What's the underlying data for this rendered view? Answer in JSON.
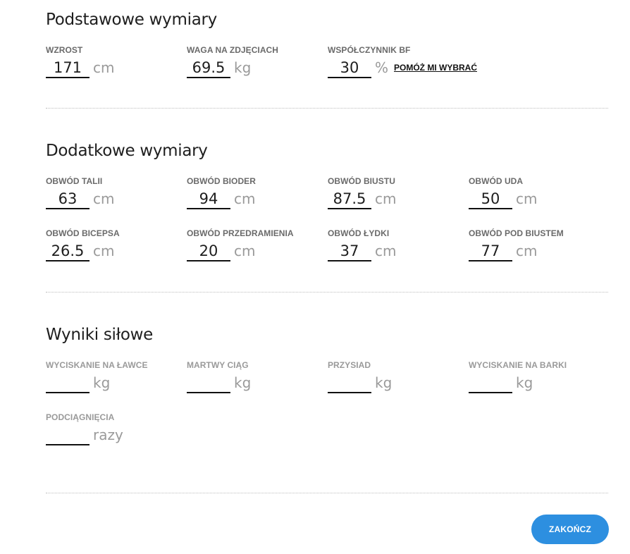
{
  "basic": {
    "title": "Podstawowe wymiary",
    "height": {
      "label": "WZROST",
      "value": "171",
      "unit": "cm"
    },
    "weight": {
      "label": "WAGA NA ZDJĘCIACH",
      "value": "69.5",
      "unit": "kg"
    },
    "body_fat": {
      "label": "WSPÓŁCZYNNIK BF",
      "value": "30",
      "unit": "%",
      "help_label": "POMÓŻ MI WYBRAĆ"
    }
  },
  "additional": {
    "title": "Dodatkowe wymiary",
    "waist": {
      "label": "OBWÓD TALII",
      "value": "63",
      "unit": "cm"
    },
    "hips": {
      "label": "OBWÓD BIODER",
      "value": "94",
      "unit": "cm"
    },
    "bust": {
      "label": "OBWÓD BIUSTU",
      "value": "87.5",
      "unit": "cm"
    },
    "thigh": {
      "label": "OBWÓD UDA",
      "value": "50",
      "unit": "cm"
    },
    "biceps": {
      "label": "OBWÓD BICEPSA",
      "value": "26.5",
      "unit": "cm"
    },
    "forearm": {
      "label": "OBWÓD PRZEDRAMIENIA",
      "value": "20",
      "unit": "cm"
    },
    "calf": {
      "label": "OBWÓD ŁYDKI",
      "value": "37",
      "unit": "cm"
    },
    "underbust": {
      "label": "OBWÓD POD BIUSTEM",
      "value": "77",
      "unit": "cm"
    }
  },
  "strength": {
    "title": "Wyniki siłowe",
    "bench_press": {
      "label": "WYCISKANIE NA ŁAWCE",
      "value": "",
      "unit": "kg"
    },
    "deadlift": {
      "label": "MARTWY CIĄG",
      "value": "",
      "unit": "kg"
    },
    "squat": {
      "label": "PRZYSIAD",
      "value": "",
      "unit": "kg"
    },
    "shoulder_press": {
      "label": "WYCISKANIE NA BARKI",
      "value": "",
      "unit": "kg"
    },
    "pullups": {
      "label": "PODCIĄGNIĘCIA",
      "value": "",
      "unit": "razy"
    }
  },
  "actions": {
    "finish_label": "ZAKOŃCZ"
  },
  "colors": {
    "accent": "#2d8fe0",
    "label_dark": "#6a6a6a",
    "label_muted": "#9a9a9a",
    "unit": "#9a9a9a",
    "divider": "#bdbdbd"
  }
}
